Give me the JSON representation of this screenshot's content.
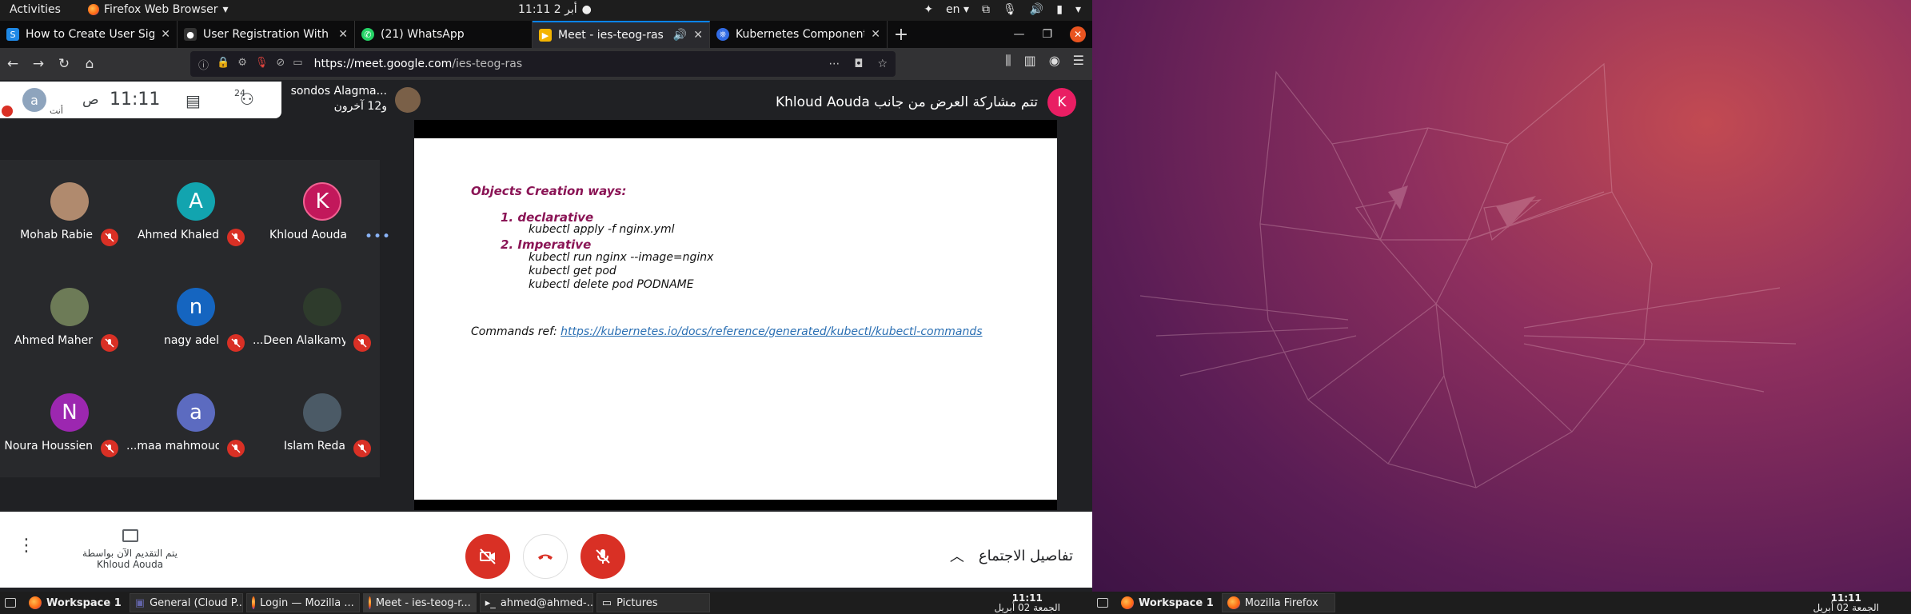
{
  "topbar": {
    "activities": "Activities",
    "app_name": "Firefox Web Browser",
    "clock": "11:11  2 أبر",
    "lang": "en"
  },
  "tabs": [
    {
      "title": "How to Create User Sign",
      "fav_color": "#1e88e5",
      "fav_letter": "S"
    },
    {
      "title": "User Registration With E",
      "fav_color": "#333333",
      "fav_letter": "●●"
    },
    {
      "title": "(21) WhatsApp",
      "fav_color": "#25d366",
      "fav_letter": "✆"
    },
    {
      "title": "Meet - ies-teog-ras",
      "fav_color": "#f4b400",
      "fav_letter": "▶",
      "active": true
    },
    {
      "title": "Kubernetes Components",
      "fav_color": "#326ce5",
      "fav_letter": "⎈"
    }
  ],
  "nav": {
    "url_host": "https://meet.google.com",
    "url_path": "/ies-teog-ras"
  },
  "meet": {
    "info": {
      "self_initial": "a",
      "self_label": "أنت",
      "ampm": "ص",
      "time": "11:11",
      "people_count": "24"
    },
    "presenters_line1": "sondos Alagma...",
    "presenters_line2": "و12 آخرون",
    "sharing_text": "تتم مشاركة العرض من جانب Khloud Aouda",
    "sharing_initial": "K",
    "participants": [
      {
        "name": "Mohab Rabie",
        "initial": "",
        "color": "#b08a6e"
      },
      {
        "name": "Ahmed Khaled",
        "initial": "A",
        "color": "#12a4af"
      },
      {
        "name": "Khloud Aouda",
        "initial": "K",
        "color": "#c2185b"
      },
      {
        "name": "Ahmed Maher",
        "initial": "",
        "color": "#6d7b57"
      },
      {
        "name": "nagy adel",
        "initial": "n",
        "color": "#1565c0"
      },
      {
        "name": "...Deen Alalkamy",
        "initial": "",
        "color": "#2e3b2c"
      },
      {
        "name": "Noura Houssien",
        "initial": "N",
        "color": "#9c27b0"
      },
      {
        "name": "...maa mahmoud",
        "initial": "a",
        "color": "#5c6bc0"
      },
      {
        "name": "Islam Reda",
        "initial": "",
        "color": "#4b5a66"
      }
    ],
    "slide": {
      "heading": "Objects Creation ways:",
      "item1": "1.  declarative",
      "cmd1": "kubectl apply -f nginx.yml",
      "item2": "2.  Imperative",
      "cmd2": "kubectl run nginx --image=nginx",
      "cmd3": "kubectl get pod",
      "cmd4": "kubectl delete pod PODNAME",
      "ref_label": "Commands ref: ",
      "ref_link": "https://kubernetes.io/docs/reference/generated/kubectl/kubectl-commands"
    },
    "controls": {
      "presenting_line1": "يتم التقديم الآن بواسطة",
      "presenting_line2": "Khloud Aouda",
      "details": "تفاصيل الاجتماع"
    }
  },
  "taskbar_left": {
    "workspace": "Workspace 1",
    "tasks": [
      "General (Cloud P...",
      "Login — Mozilla ...",
      "Meet - ies-teog-r...",
      "ahmed@ahmed-...",
      "Pictures"
    ],
    "time": "11:11",
    "date": "الجمعة 02 أبريل"
  },
  "taskbar_right": {
    "workspace": "Workspace 1",
    "task": "Mozilla Firefox",
    "time": "11:11",
    "date": "الجمعة 02 أبريل"
  }
}
